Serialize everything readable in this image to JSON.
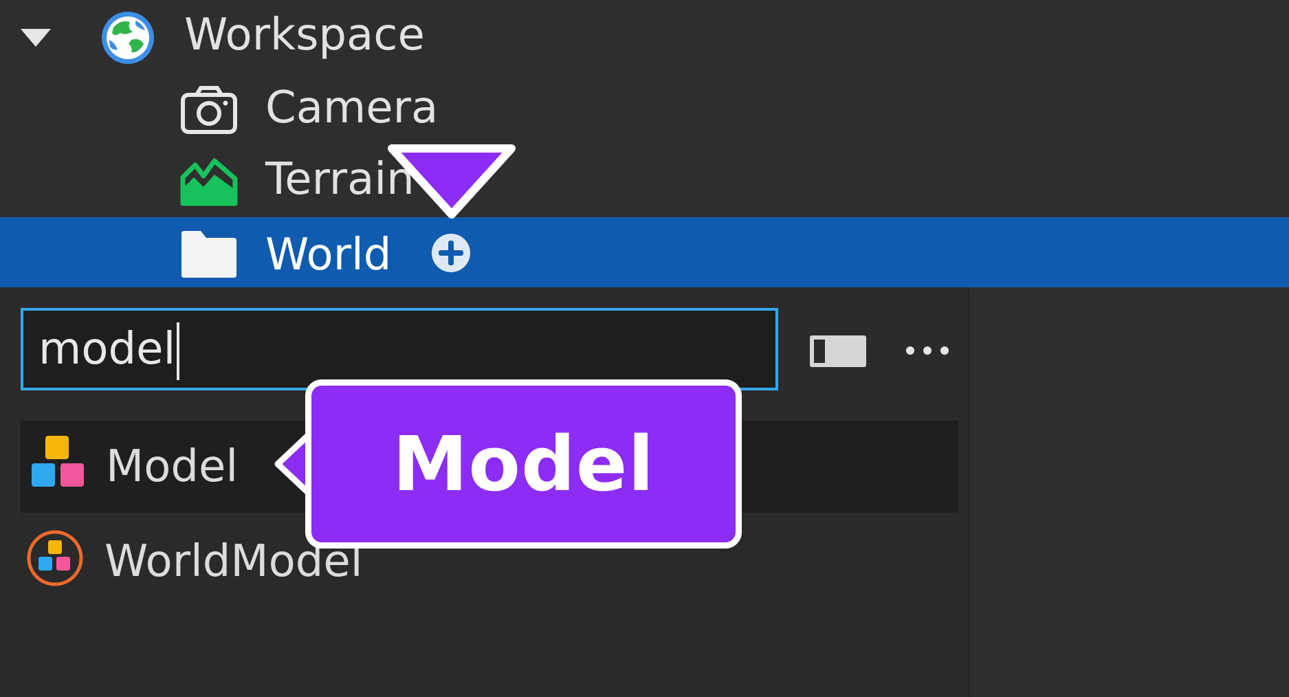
{
  "explorer": {
    "items": [
      {
        "label": "Workspace",
        "icon": "globe-icon",
        "expanded": true
      },
      {
        "label": "Camera",
        "icon": "camera-icon"
      },
      {
        "label": "Terrain",
        "icon": "terrain-icon"
      },
      {
        "label": "World",
        "icon": "folder-icon",
        "selected": true,
        "action_icon": "plus-circle-icon"
      }
    ]
  },
  "insert_panel": {
    "search_value": "model",
    "toggle_icon": "toggle-icon",
    "more_icon": "more-options-icon",
    "results": [
      {
        "label": "Model",
        "icon": "model-icon"
      },
      {
        "label": "WorldModel",
        "icon": "worldmodel-icon"
      }
    ]
  },
  "callouts": {
    "arrow_marker": "down-arrow-marker",
    "label_text": "Model"
  },
  "colors": {
    "selection": "#0f5bb0",
    "search_border": "#34a9ea",
    "callout": "#8c2cf5"
  }
}
